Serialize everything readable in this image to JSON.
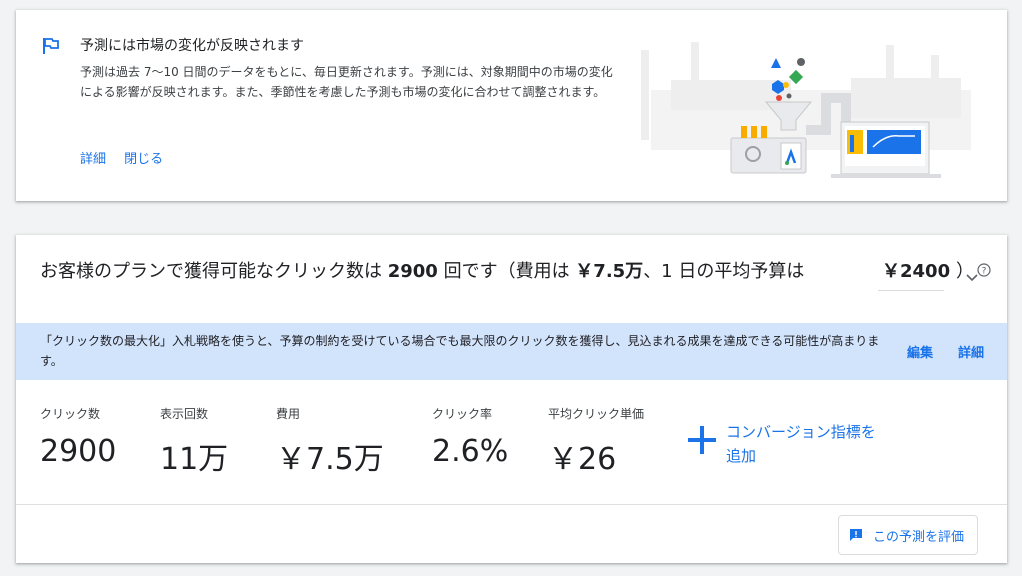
{
  "notice": {
    "title": "予測には市場の変化が反映されます",
    "body": "予測は過去 7〜10 日間のデータをもとに、毎日更新されます。予測には、対象期間中の市場の変化による影響が反映されます。また、季節性を考慮した予測も市場の変化に合わせて調整されます。",
    "details_link": "詳細",
    "close_link": "閉じる",
    "icon": "flag-icon"
  },
  "forecast": {
    "headline_prefix": "お客様のプランで獲得可能なクリック数は ",
    "clicks_bold": "2900",
    "headline_mid1": " 回です（費用は ",
    "cost_bold": "￥7.5万",
    "headline_mid2": "、1 日の平均予算は",
    "budget_value": "￥2400",
    "budget_close": "）",
    "banner": {
      "message": "「クリック数の最大化」入札戦略を使うと、予算の制約を受けている場合でも最大限のクリック数を獲得し、見込まれる成果を達成できる可能性が高まります。",
      "edit": "編集",
      "details": "詳細"
    },
    "metrics": [
      {
        "label": "クリック数",
        "value": "2900"
      },
      {
        "label": "表示回数",
        "value": "11万"
      },
      {
        "label": "費用",
        "value": "￥7.5万"
      },
      {
        "label": "クリック率",
        "value": "2.6%"
      },
      {
        "label": "平均クリック単価",
        "value": "￥26"
      }
    ],
    "add_conversion": "コンバージョン指標を追加",
    "rate_button": "この予測を評価"
  },
  "colors": {
    "accent": "#1a73e8",
    "banner_bg": "#d2e3fc",
    "page_bg": "#f1f3f4"
  }
}
